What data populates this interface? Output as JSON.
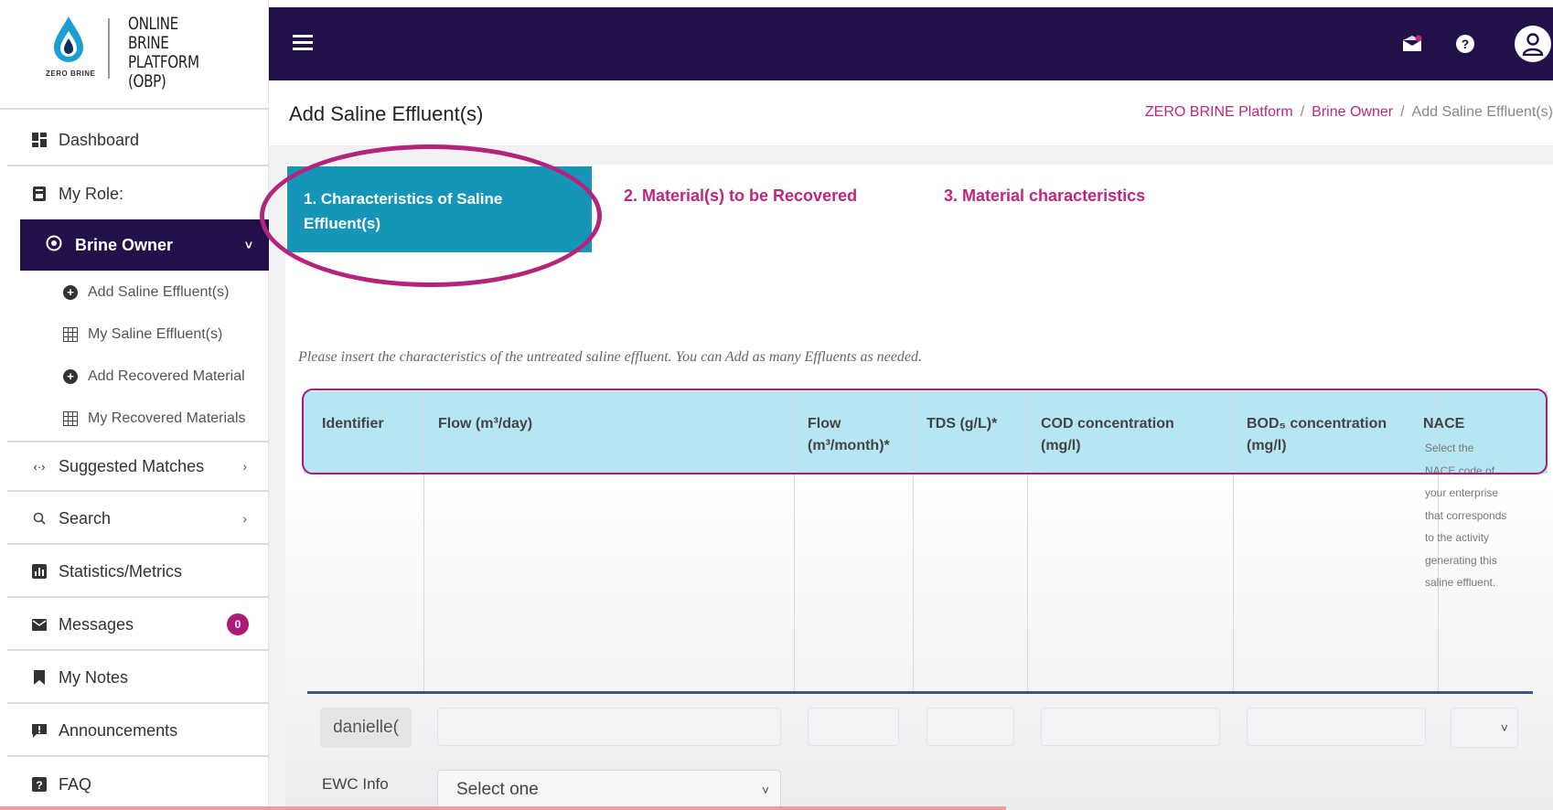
{
  "brand": {
    "title_lines": [
      "ONLINE",
      "BRINE",
      "PLATFORM (OBP)"
    ],
    "small_text": "ZERO BRINE"
  },
  "sidebar": {
    "dashboard": "Dashboard",
    "my_role": "My Role:",
    "active_role": "Brine Owner",
    "sub_items": [
      "Add Saline Effluent(s)",
      "My Saline Effluent(s)",
      "Add Recovered Material",
      "My Recovered Materials"
    ],
    "suggested_matches": "Suggested Matches",
    "search": "Search",
    "statistics": "Statistics/Metrics",
    "messages": "Messages",
    "messages_count": "0",
    "notes": "My Notes",
    "announcements": "Announcements",
    "faq": "FAQ"
  },
  "header": {
    "page_title": "Add Saline Effluent(s)",
    "breadcrumb": [
      "ZERO BRINE Platform",
      "Brine Owner",
      "Add Saline Effluent(s)"
    ]
  },
  "wizard": {
    "step1": "1. Characteristics of Saline Effluent(s)",
    "step2": "2. Material(s) to be Recovered",
    "step3": "3. Material characteristics"
  },
  "instructions": "Please insert the characteristics of the untreated saline effluent. You can Add as many Effluents as needed.",
  "table": {
    "columns": {
      "identifier": "Identifier",
      "flow_day": "Flow (m³/day)",
      "flow_month": "Flow (m³/month)*",
      "tds": "TDS (g/L)*",
      "cod": "COD concentration (mg/l)",
      "bod": "BOD₅ concentration (mg/l)",
      "nace": "NACE"
    },
    "nace_help": "Select the NACE code of your enterprise that corresponds to the activity generating this saline effluent.",
    "identifier_value": "danielle(",
    "ewc_label": "EWC Info",
    "ewc_select": "Select one"
  },
  "colors": {
    "topbar": "#241049",
    "accent": "#c0267f",
    "step_active": "#1595b8",
    "table_header": "#b6e6f2"
  }
}
